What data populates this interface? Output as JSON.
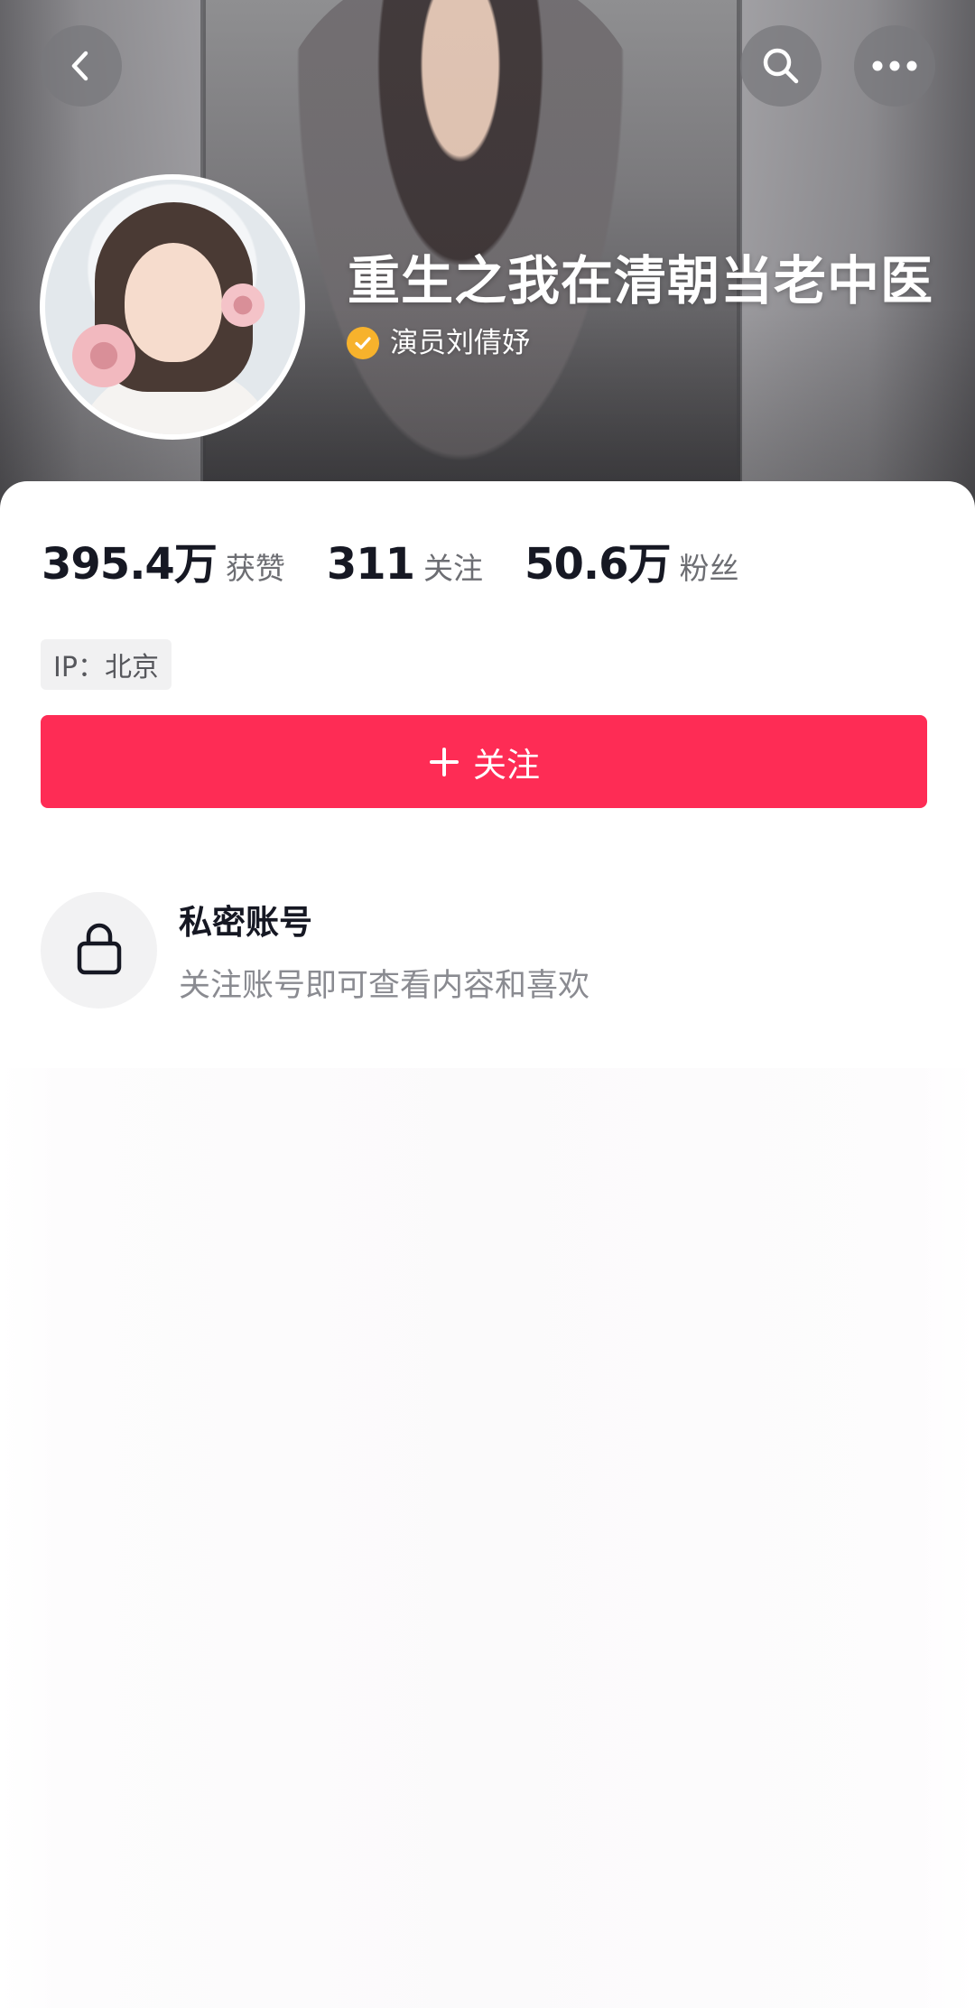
{
  "header": {
    "back_icon": "chevron-left-icon",
    "search_icon": "search-icon",
    "more_icon": "more-dots-icon",
    "nickname": "重生之我在清朝当老中医",
    "verified": {
      "badge_icon": "verified-check-icon",
      "badge_color": "#f7b22c",
      "text": "演员刘倩妤"
    }
  },
  "stats": [
    {
      "value": "395.4万",
      "label": "获赞"
    },
    {
      "value": "311",
      "label": "关注"
    },
    {
      "value": "50.6万",
      "label": "粉丝"
    }
  ],
  "ip_location": "IP：北京",
  "follow_button": {
    "icon": "plus-icon",
    "label": "关注",
    "color": "#fe2c55"
  },
  "private_account": {
    "icon": "lock-icon",
    "title": "私密账号",
    "description": "关注账号即可查看内容和喜欢"
  }
}
